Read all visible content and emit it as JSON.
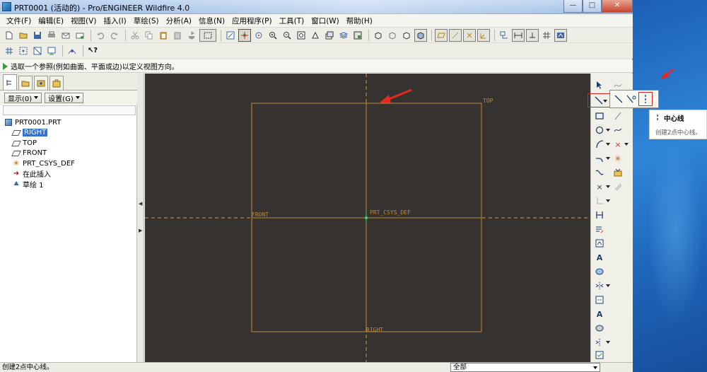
{
  "window": {
    "title": "PRT0001 (活动的) - Pro/ENGINEER Wildfire 4.0",
    "min_glyph": "—",
    "max_glyph": "□",
    "close_glyph": "✕"
  },
  "menu": [
    "文件(F)",
    "编辑(E)",
    "视图(V)",
    "插入(I)",
    "草绘(S)",
    "分析(A)",
    "信息(N)",
    "应用程序(P)",
    "工具(T)",
    "窗口(W)",
    "帮助(H)"
  ],
  "message": "选取一个参照(例如曲面、平面或边)以定义视图方向。",
  "navigator": {
    "show_label": "显示(0)",
    "settings_label": "设置(G)",
    "tree": {
      "root": "PRT0001.PRT",
      "items": [
        {
          "label": "RIGHT",
          "icon": "datum-plane-icon",
          "selected": true
        },
        {
          "label": "TOP",
          "icon": "datum-plane-icon"
        },
        {
          "label": "FRONT",
          "icon": "datum-plane-icon"
        },
        {
          "label": "PRT_CSYS_DEF",
          "icon": "csys-icon"
        },
        {
          "label": "在此插入",
          "icon": "insert-arrow-icon"
        },
        {
          "label": "草绘 1",
          "icon": "sketch-icon"
        }
      ]
    }
  },
  "graphics": {
    "planes": {
      "top": "TOP",
      "front": "FRONT",
      "right": "RIGHT",
      "csys": "PRT_CSYS_DEF"
    },
    "colors": {
      "background": "#353230",
      "datum": "#c48a3d",
      "csys": "#3fd27a"
    }
  },
  "sketch_tools": {
    "flyout_tip_title": "中心线",
    "flyout_tip_desc": "创建2点中心线。"
  },
  "status": {
    "text": "创建2点中心线。",
    "filter": "全部"
  },
  "colors": {
    "annotation_red": "#e5291f"
  }
}
